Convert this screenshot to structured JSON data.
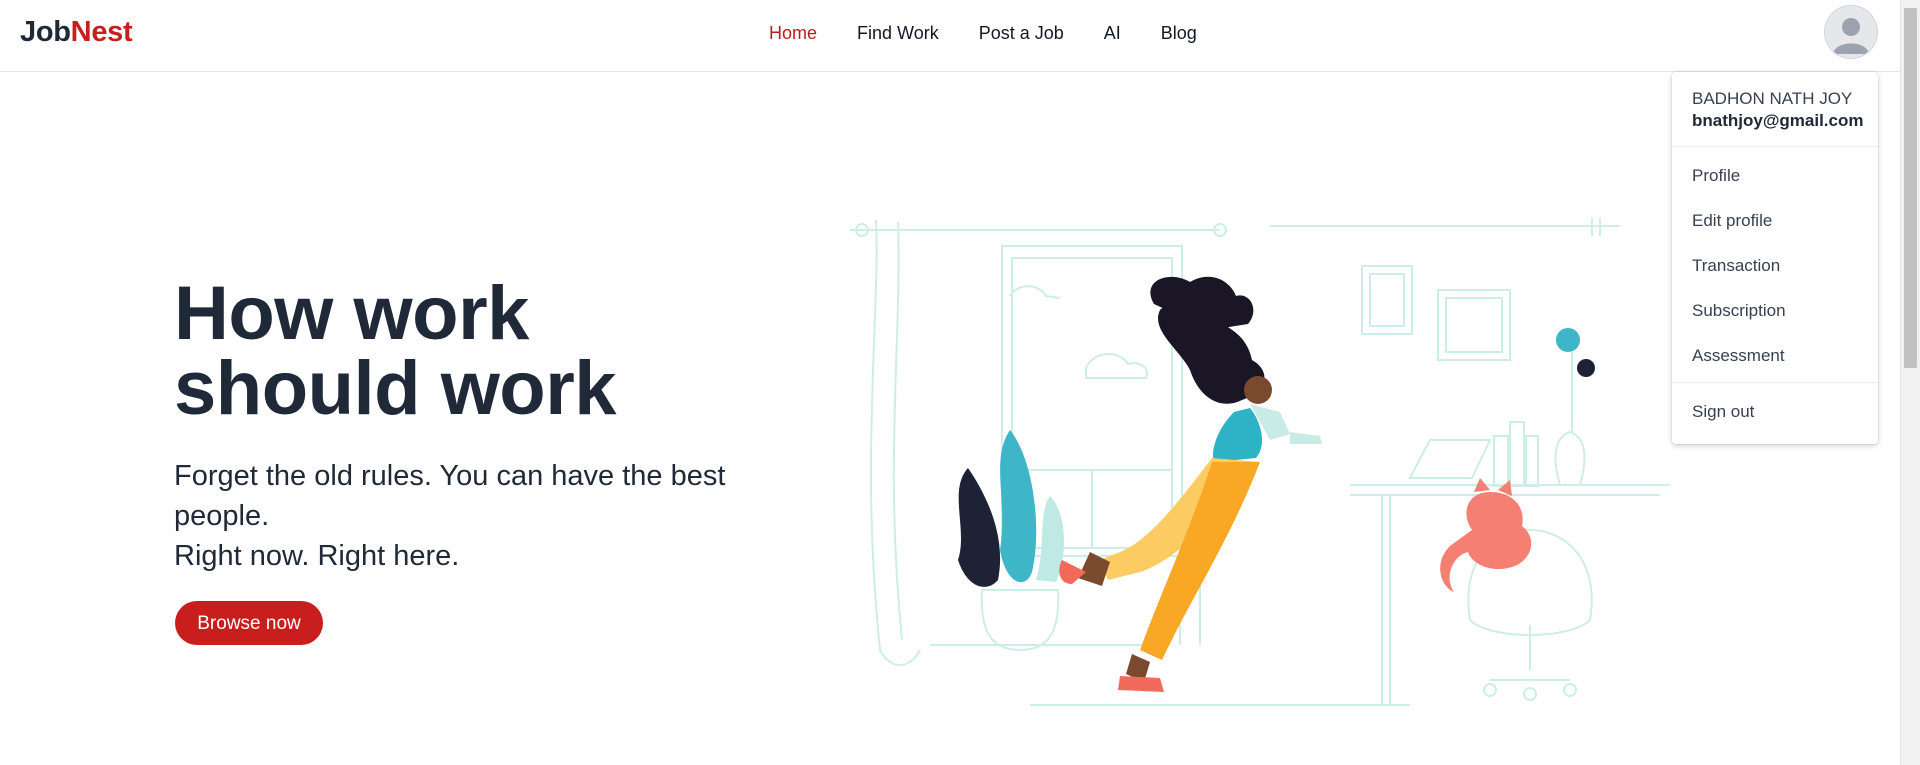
{
  "brand": {
    "part1": "Job",
    "part2": "Nest",
    "accent_color": "#c81e1e"
  },
  "nav": {
    "items": [
      {
        "label": "Home",
        "active": true
      },
      {
        "label": "Find Work",
        "active": false
      },
      {
        "label": "Post a Job",
        "active": false
      },
      {
        "label": "AI",
        "active": false
      },
      {
        "label": "Blog",
        "active": false
      }
    ]
  },
  "user_menu": {
    "avatar_icon": "user-avatar-icon",
    "name": "BADHON NATH JOY",
    "email": "bnathjoy@gmail.com",
    "items": [
      {
        "label": "Profile"
      },
      {
        "label": "Edit profile"
      },
      {
        "label": "Transaction"
      },
      {
        "label": "Subscription"
      },
      {
        "label": "Assessment"
      }
    ],
    "sign_out": "Sign out"
  },
  "hero": {
    "title_line1": "How work",
    "title_line2": "should work",
    "subtitle_line1": "Forget the old rules. You can have the best",
    "subtitle_line2": "people.",
    "subtitle_line3": "Right now. Right here.",
    "cta_label": "Browse now"
  }
}
